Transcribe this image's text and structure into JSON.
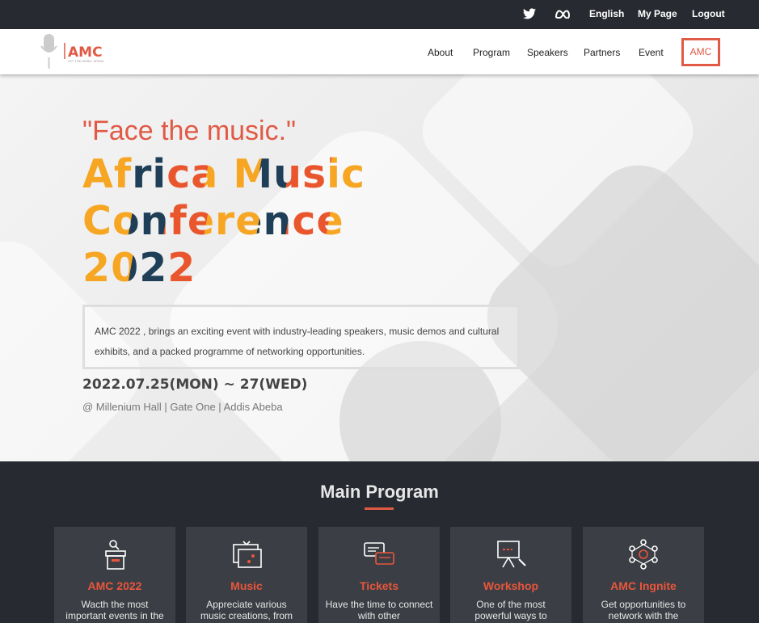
{
  "topbar": {
    "twitter_icon": "twitter-icon",
    "meta_icon": "meta-icon",
    "language": "English",
    "my_page": "My Page",
    "logout": "Logout"
  },
  "header": {
    "logo_text": "AMC",
    "logo_tagline": "LET THE MUSIC SPEAK",
    "nav": [
      "About",
      "Program",
      "Speakers",
      "Partners",
      "Event",
      "AMC"
    ]
  },
  "hero": {
    "tagline": "\"Face the music.\"",
    "title_lines": [
      "Africa Music",
      "Conference",
      "2022"
    ],
    "description": "AMC 2022 , brings an exciting event with industry-leading speakers, music demos and cultural exhibits, and a packed programme of networking opportunities.",
    "date": "2022.07.25(MON) ~ 27(WED)",
    "venue": "@ Millenium Hall | Gate One | Addis Abeba"
  },
  "program": {
    "title": "Main Program",
    "cards": [
      {
        "icon": "podium-icon",
        "title": "AMC 2022",
        "text": "Wacth the most important events in the"
      },
      {
        "icon": "easel-icon",
        "title": "Music",
        "text": "Appreciate various music creations, from"
      },
      {
        "icon": "chat-icon",
        "title": "Tickets",
        "text": "Have the time to connect with other"
      },
      {
        "icon": "presentation-board-icon",
        "title": "Workshop",
        "text": "One of the most powerful ways to"
      },
      {
        "icon": "network-icon",
        "title": "AMC Ingnite",
        "text": "Get opportunities to network with the"
      }
    ]
  },
  "colors": {
    "accent": "#e05a45",
    "dark_bg": "#272a30",
    "card_bg": "#3b3e44"
  }
}
